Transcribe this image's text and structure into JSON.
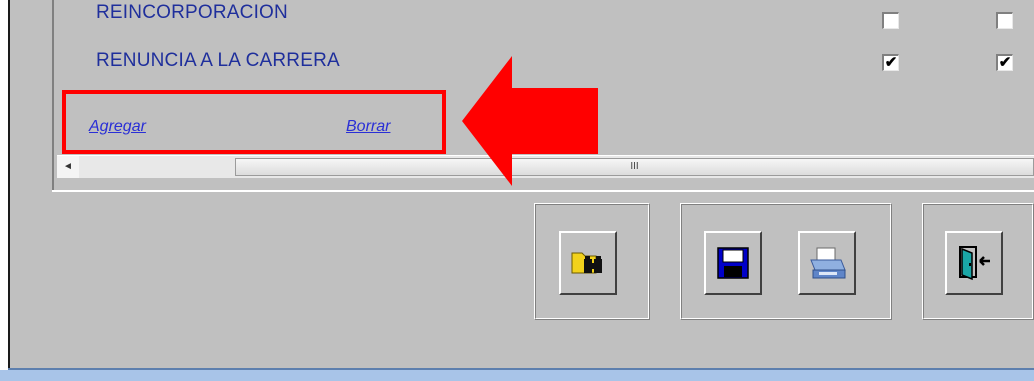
{
  "grid": {
    "rows": [
      {
        "label": "REINCORPORACION",
        "col1_checked": false,
        "col2_checked": false
      },
      {
        "label": "RENUNCIA A LA CARRERA",
        "col1_checked": true,
        "col2_checked": true
      }
    ],
    "check_mark": "✔"
  },
  "actions": {
    "add_label": "Agregar",
    "delete_label": "Borrar"
  },
  "scrollbar": {
    "left_arrow": "◄",
    "thumb_grip": "III"
  },
  "toolbar": {
    "buttons": [
      {
        "icon": "search-folder-icon"
      },
      {
        "icon": "save-disk-icon"
      },
      {
        "icon": "printer-icon"
      },
      {
        "icon": "exit-door-icon"
      }
    ]
  },
  "colors": {
    "label_blue": "#1f2f9c",
    "link_blue": "#2a2fd6",
    "highlight_red": "#ff0000",
    "background": "#c0c0c0"
  }
}
